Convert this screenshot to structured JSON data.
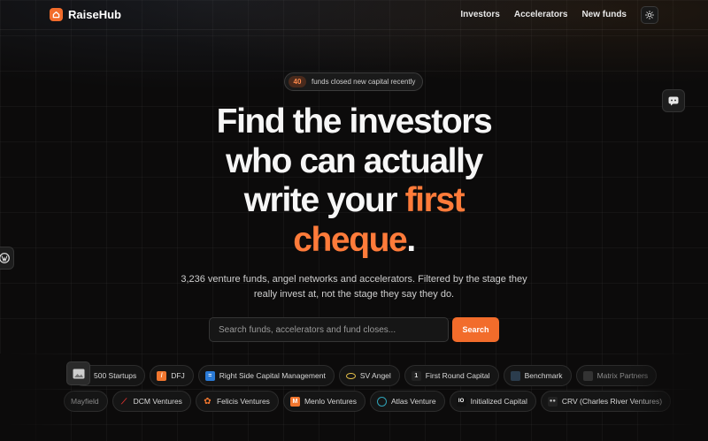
{
  "brand": {
    "name": "RaiseHub",
    "accent_color": "#f26c2b"
  },
  "nav": {
    "items": [
      {
        "label": "Investors"
      },
      {
        "label": "Accelerators"
      },
      {
        "label": "New funds"
      }
    ],
    "theme_toggle_icon": "sun-icon"
  },
  "badge": {
    "count": "40",
    "text": "funds closed new capital recently"
  },
  "hero": {
    "line1": "Find the investors",
    "line2": "who can actually",
    "line3_plain": "write your ",
    "line3_accent": "first",
    "line4_accent": "cheque",
    "line4_plain": ".",
    "subtitle": "3,236 venture funds, angel networks and accelerators. Filtered by the stage they really invest at, not the stage they say they do."
  },
  "search": {
    "placeholder": "Search funds, accelerators and fund closes...",
    "button_label": "Search"
  },
  "chips_row1": [
    {
      "label": "500 Startups",
      "icon": "500-startups-logo"
    },
    {
      "label": "DFJ",
      "icon": "dfj-logo"
    },
    {
      "label": "Right Side Capital Management",
      "icon": "rscm-logo"
    },
    {
      "label": "SV Angel",
      "icon": "sv-angel-logo"
    },
    {
      "label": "First Round Capital",
      "icon": "first-round-logo"
    },
    {
      "label": "Benchmark",
      "icon": "benchmark-logo"
    },
    {
      "label": "Matrix Partners",
      "icon": "matrix-logo"
    }
  ],
  "chips_row2": [
    {
      "label": "Mayfield",
      "icon": ""
    },
    {
      "label": "DCM Ventures",
      "icon": "dcm-logo"
    },
    {
      "label": "Felicis Ventures",
      "icon": "felicis-logo"
    },
    {
      "label": "Menlo Ventures",
      "icon": "menlo-logo"
    },
    {
      "label": "Atlas Venture",
      "icon": "atlas-logo"
    },
    {
      "label": "Initialized Capital",
      "icon": "initialized-logo"
    },
    {
      "label": "CRV (Charles River Ventures)",
      "icon": "crv-logo"
    }
  ],
  "colors": {
    "background": "#0c0b0b",
    "accent": "#ff7b3a"
  }
}
